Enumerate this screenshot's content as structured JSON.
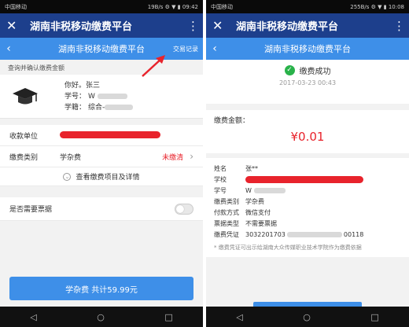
{
  "left": {
    "status": {
      "carrier": "中国移动",
      "right": "19B/s ⚙ ▼ ▮ 09:42"
    },
    "title": "湖南非税移动缴费平台",
    "subtitle": "湖南非税移动缴费平台",
    "link": "交易记录",
    "section": "查询并确认缴费金额",
    "user": {
      "greeting": "你好。张三",
      "id_label": "学号：",
      "id_value": "W",
      "school_label": "学籍：",
      "school_value": "综合-"
    },
    "rows": {
      "payee_label": "收款单位",
      "category_label": "缴费类别",
      "category_value": "学杂费",
      "category_status": "未缴清"
    },
    "detail_link": "查看缴费项目及详情",
    "receipt_label": "是否需要票据",
    "pay_button": "学杂费 共计59.99元"
  },
  "right": {
    "status": {
      "carrier": "中国移动",
      "right": "255B/s ⚙ ▼ ▮ 10:08"
    },
    "title": "湖南非税移动缴费平台",
    "subtitle": "湖南非税移动缴费平台",
    "success": "缴费成功",
    "time": "2017-03-23 00:43",
    "amount_label": "缴费金额：",
    "amount": "¥0.01",
    "fields": [
      {
        "k": "姓名",
        "v": "张**"
      },
      {
        "k": "学校",
        "v": ""
      },
      {
        "k": "学号",
        "v": "W"
      },
      {
        "k": "缴费类别",
        "v": "学杂费"
      },
      {
        "k": "付款方式",
        "v": "微信支付"
      },
      {
        "k": "票据类型",
        "v": "不需要票据"
      },
      {
        "k": "缴费凭证",
        "v": "3032201703",
        "v2": "00118"
      }
    ],
    "note": "* 缴费凭证可出示给湖南大众传媒职业技术学院作为缴费依据"
  },
  "colors": {
    "title_bar": "#1d3f8c",
    "sub_bar": "#3e8fe8",
    "red": "#e8232c",
    "success": "#29b24a"
  },
  "icons": {
    "close": "close-icon",
    "menu": "more-vert-icon",
    "back": "chevron-left-icon",
    "avatar": "graduation-cap-icon",
    "success": "check-circle-icon"
  }
}
